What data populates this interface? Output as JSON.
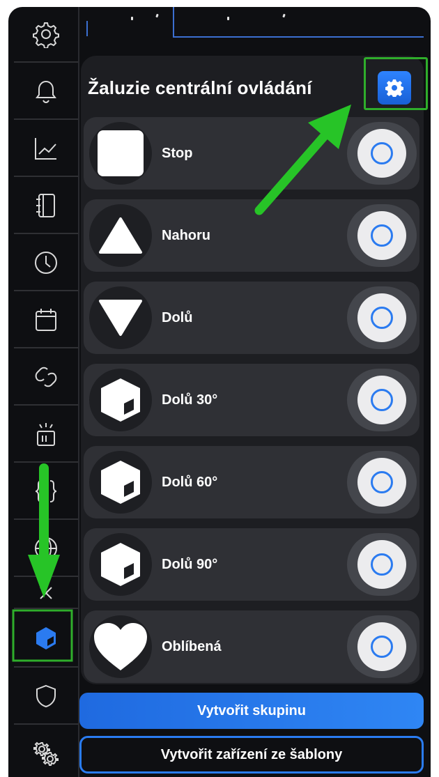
{
  "panel": {
    "title": "Žaluzie centrální ovládání",
    "settings_icon": "gear-icon"
  },
  "rows": [
    {
      "label": "Stop",
      "icon": "stop-square-icon"
    },
    {
      "label": "Nahoru",
      "icon": "triangle-up-icon"
    },
    {
      "label": "Dolů",
      "icon": "triangle-down-icon"
    },
    {
      "label": "Dolů 30°",
      "icon": "cube-icon"
    },
    {
      "label": "Dolů 60°",
      "icon": "cube-icon"
    },
    {
      "label": "Dolů 90°",
      "icon": "cube-icon"
    },
    {
      "label": "Oblíbená",
      "icon": "heart-icon"
    }
  ],
  "buttons": {
    "create_group": "Vytvořit skupinu",
    "create_from_template": "Vytvořit zařízení ze šablony"
  },
  "sidebar": {
    "items": [
      {
        "icon": "gear-icon"
      },
      {
        "icon": "bell-icon"
      },
      {
        "icon": "chart-icon"
      },
      {
        "icon": "notebook-icon"
      },
      {
        "icon": "clock-icon"
      },
      {
        "icon": "calendar-icon"
      },
      {
        "icon": "link-icon"
      },
      {
        "icon": "signal-icon"
      },
      {
        "icon": "braces-icon"
      },
      {
        "icon": "globe-icon"
      },
      {
        "icon": "close-icon"
      },
      {
        "icon": "cube-icon",
        "active": true
      },
      {
        "icon": "shield-icon"
      },
      {
        "icon": "gears-icon"
      }
    ]
  },
  "colors": {
    "accent": "#2b7bf0",
    "annotation": "#2fae2b",
    "background": "#0e0f12",
    "panel": "#1d1e22",
    "row": "#2f3035"
  }
}
